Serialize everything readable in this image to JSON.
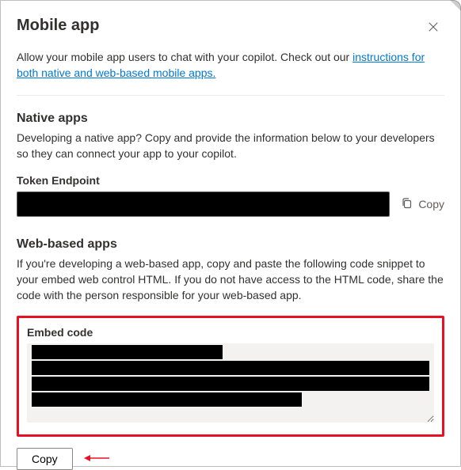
{
  "header": {
    "title": "Mobile app",
    "close_icon": "×"
  },
  "intro": {
    "text_before": "Allow your mobile app users to chat with your copilot. Check out our ",
    "link_text": "instructions for both native and web-based mobile apps.",
    "text_after": ""
  },
  "native": {
    "heading": "Native apps",
    "description": "Developing a native app? Copy and provide the information below to your developers so they can connect your app to your copilot.",
    "token_label": "Token Endpoint",
    "token_value": "████████████████████████████████████████",
    "copy_label": "Copy"
  },
  "web": {
    "heading": "Web-based apps",
    "description": "If you're developing a web-based app, copy and paste the following code snippet to your embed web control HTML. If you do not have access to the HTML code, share the code with the person responsible for your web-based app.",
    "embed_label": "Embed code",
    "embed_value": "",
    "copy_button": "Copy"
  },
  "annotation": {
    "highlight_color": "#e81123",
    "arrow_color": "#e81123"
  }
}
